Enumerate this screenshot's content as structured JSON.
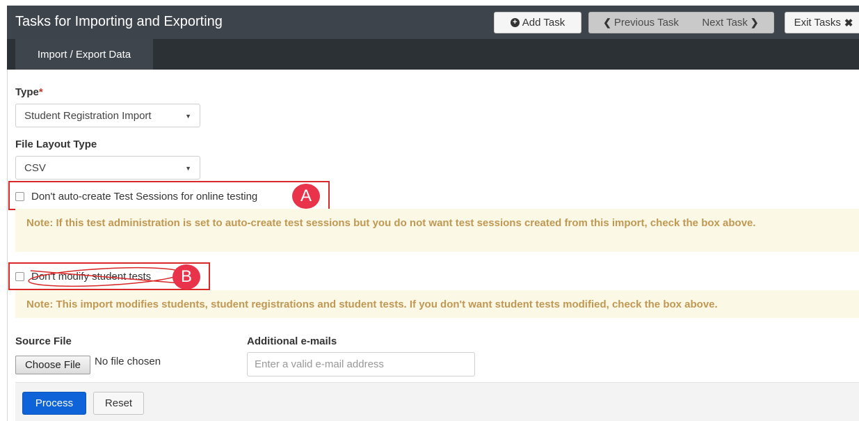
{
  "header": {
    "title": "Tasks for Importing and Exporting",
    "add_task": "Add Task",
    "previous_task": "Previous Task",
    "next_task": "Next Task",
    "exit_tasks": "Exit Tasks"
  },
  "tabs": [
    {
      "label": "Import / Export Data"
    }
  ],
  "form": {
    "type_label": "Type",
    "required_marker": "*",
    "type_value": "Student Registration Import",
    "file_layout_label": "File Layout Type",
    "file_layout_value": "CSV",
    "checkbox_sessions_label": "Don't auto-create Test Sessions for online testing",
    "checkbox_sessions_checked": false,
    "note_sessions": "Note: If this test administration is set to auto-create test sessions but you do not want test sessions created from this import, check the box above.",
    "checkbox_modify_label": "Don't modify student tests",
    "checkbox_modify_checked": false,
    "note_modify": "Note: This import modifies students, student registrations and student tests. If you don't want student tests modified, check the box above.",
    "source_file_label": "Source File",
    "choose_file_button": "Choose File",
    "no_file_text": "No file chosen",
    "emails_label": "Additional e-mails",
    "emails_placeholder": "Enter a valid e-mail address",
    "emails_value": ""
  },
  "annotations": {
    "a": "A",
    "b": "B"
  },
  "actions": {
    "process": "Process",
    "reset": "Reset"
  },
  "colors": {
    "accent": "#0e63d9",
    "header_bg": "#3e444b",
    "note_bg": "#fcf8e6",
    "note_text": "#c09853",
    "annotation_red": "#e8334a"
  }
}
